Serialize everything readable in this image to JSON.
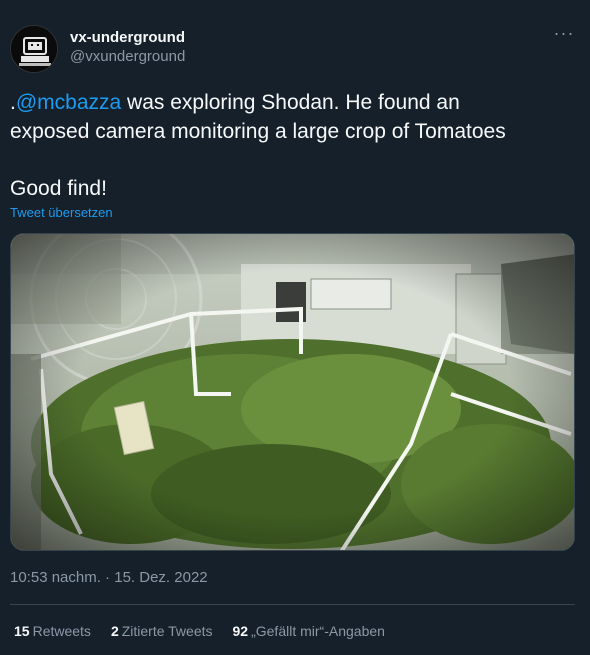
{
  "author": {
    "display_name": "vx-underground",
    "handle": "@vxunderground",
    "avatar_icon": "retro-computer-logo-icon"
  },
  "menu": {
    "more_label": "···"
  },
  "tweet": {
    "prefix": ".",
    "mention": "@mcbazza",
    "line1_rest": " was exploring Shodan. He found an",
    "line2": "exposed camera monitoring a large crop of Tomatoes",
    "line3": "Good find!",
    "translate": "Tweet übersetzen"
  },
  "timestamp": "10:53 nachm. · 15. Dez. 2022",
  "stats": [
    {
      "count": "15",
      "label": "Retweets"
    },
    {
      "count": "2",
      "label": "Zitierte Tweets"
    },
    {
      "count": "92",
      "label": "„Gefällt mir“-Angaben"
    }
  ],
  "colors": {
    "background": "#15202b",
    "accent": "#1d9bf0",
    "muted": "#8b98a5",
    "border": "#38444d"
  }
}
